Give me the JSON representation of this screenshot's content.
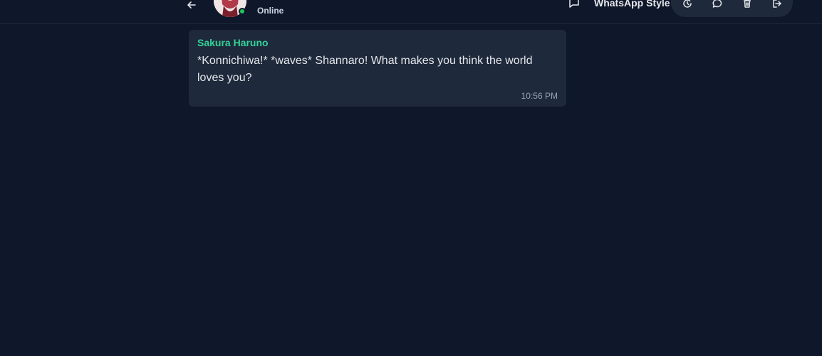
{
  "header": {
    "status": "Online",
    "style_label": "WhatsApp Style",
    "icons": {
      "back": "arrow-left-icon",
      "chat": "chat-bubble-icon",
      "history": "history-icon",
      "comment": "comment-icon",
      "delete": "trash-icon",
      "logout": "logout-icon"
    },
    "colors": {
      "online": "#22c55e",
      "background": "#0f172a",
      "panel": "#1e293b"
    }
  },
  "messages": [
    {
      "sender": "Sakura Haruno",
      "text": "*Konnichiwa!* *waves* Shannaro! What makes you think the world loves you?",
      "time": "10:56 PM",
      "sender_color": "#34d399"
    }
  ]
}
